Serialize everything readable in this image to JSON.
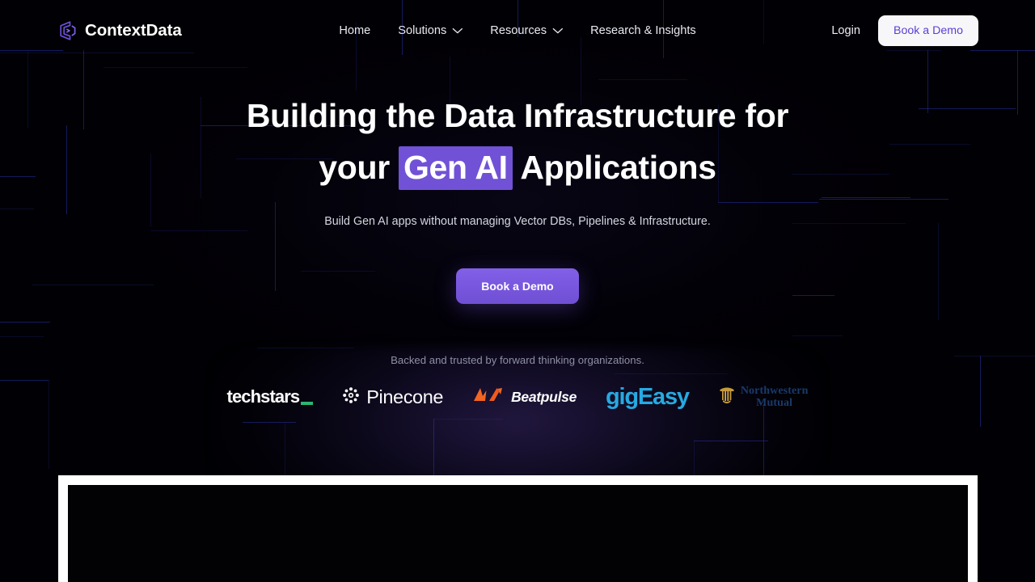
{
  "brand": {
    "name": "ContextData",
    "logo_icon": "contextdata-hex-logo-icon",
    "accent": "#6b4fd6"
  },
  "nav": {
    "items": [
      {
        "label": "Home",
        "has_dropdown": false
      },
      {
        "label": "Solutions",
        "has_dropdown": true
      },
      {
        "label": "Resources",
        "has_dropdown": true
      },
      {
        "label": "Research & Insights",
        "has_dropdown": false
      }
    ]
  },
  "header_actions": {
    "login_label": "Login",
    "demo_label": "Book a Demo",
    "demo_bg": "#f7f7f9",
    "demo_text_color": "#5b3ed6"
  },
  "hero": {
    "heading_part1": "Building the Data Infrastructure for",
    "heading_part2_pre": "your ",
    "heading_highlight": "Gen AI",
    "heading_part2_post": " Applications",
    "highlight_bg": "#7152d6",
    "subtitle": "Build Gen AI apps without managing Vector DBs, Pipelines & Infrastructure.",
    "cta_label": "Book a Demo",
    "cta_bg": "#7152d6"
  },
  "trusted": {
    "label": "Backed and trusted by forward thinking organizations.",
    "logos": [
      {
        "name": "techstars",
        "text": "techstars",
        "accent": "#2bb673"
      },
      {
        "name": "pinecone",
        "text": "Pinecone",
        "icon": "pinecone-burst-icon",
        "accent": "#ffffff"
      },
      {
        "name": "beatpulse",
        "text": "Beatpulse",
        "icon": "beatpulse-chevrons-icon",
        "accent": "#f26522"
      },
      {
        "name": "gigeasy",
        "text": "gigEasy",
        "accent": "#27a9e1"
      },
      {
        "name": "northwestern-mutual",
        "line1": "Northwestern",
        "line2": "Mutual",
        "icon": "nm-column-icon",
        "accent": "#c79a3b"
      }
    ]
  },
  "bottom_panel": {
    "frame_color": "#ffffff",
    "inner_color": "#020205"
  }
}
